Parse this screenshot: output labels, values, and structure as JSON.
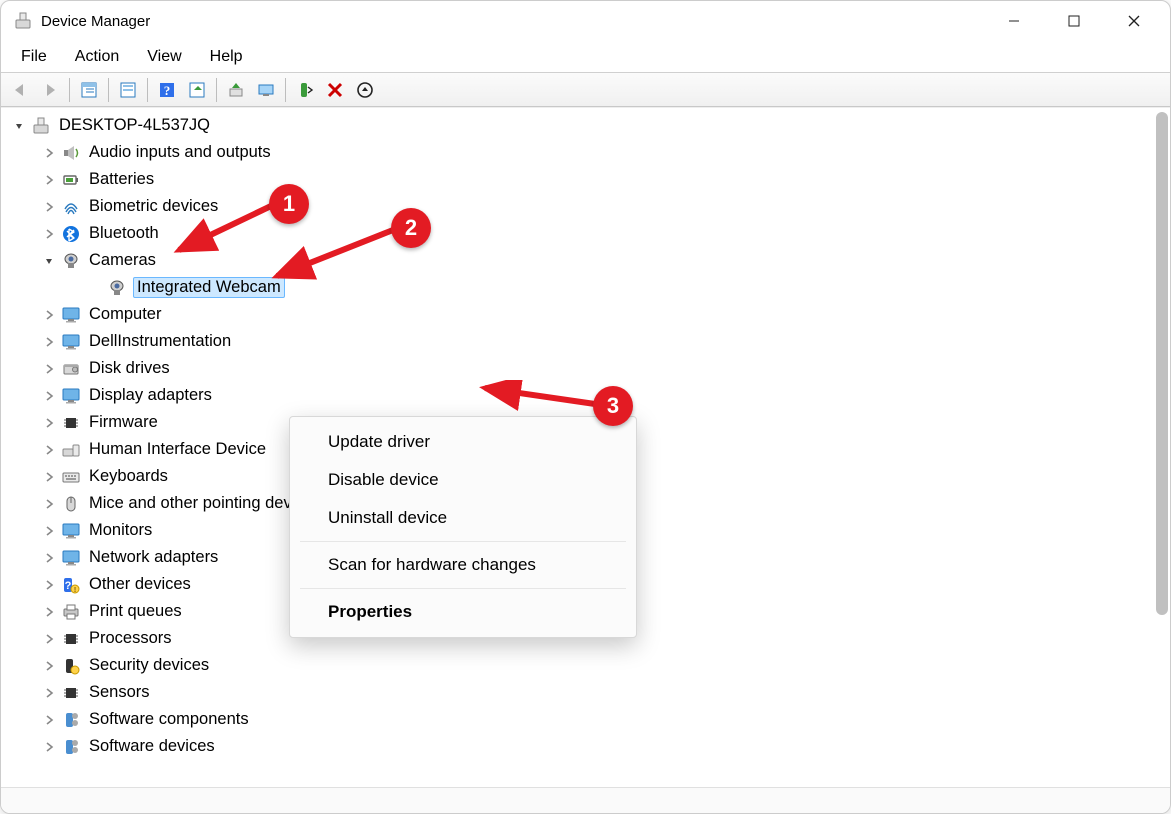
{
  "window": {
    "title": "Device Manager"
  },
  "menu": {
    "file": "File",
    "action": "Action",
    "view": "View",
    "help": "Help"
  },
  "tree": {
    "root": "DESKTOP-4L537JQ",
    "categories": [
      {
        "label": "Audio inputs and outputs"
      },
      {
        "label": "Batteries"
      },
      {
        "label": "Biometric devices"
      },
      {
        "label": "Bluetooth"
      },
      {
        "label": "Cameras",
        "expanded": true,
        "children": [
          {
            "label": "Integrated Webcam",
            "selected": true
          }
        ]
      },
      {
        "label": "Computer"
      },
      {
        "label": "DellInstrumentation"
      },
      {
        "label": "Disk drives"
      },
      {
        "label": "Display adapters"
      },
      {
        "label": "Firmware"
      },
      {
        "label": "Human Interface Device"
      },
      {
        "label": "Keyboards"
      },
      {
        "label": "Mice and other pointing devices"
      },
      {
        "label": "Monitors"
      },
      {
        "label": "Network adapters"
      },
      {
        "label": "Other devices"
      },
      {
        "label": "Print queues"
      },
      {
        "label": "Processors"
      },
      {
        "label": "Security devices"
      },
      {
        "label": "Sensors"
      },
      {
        "label": "Software components"
      },
      {
        "label": "Software devices"
      }
    ]
  },
  "icons": {
    "Audio inputs and outputs": "speaker",
    "Batteries": "battery",
    "Biometric devices": "fingerprint",
    "Bluetooth": "bluetooth",
    "Cameras": "camera",
    "Computer": "monitor",
    "DellInstrumentation": "monitor",
    "Disk drives": "disk",
    "Display adapters": "monitor",
    "Firmware": "chip",
    "Human Interface Device": "hid",
    "Keyboards": "keyboard",
    "Mice and other pointing devices": "mouse",
    "Monitors": "monitor",
    "Network adapters": "monitor",
    "Other devices": "question",
    "Print queues": "printer",
    "Processors": "chip",
    "Security devices": "security",
    "Sensors": "chip",
    "Software components": "soft",
    "Software devices": "soft",
    "Integrated Webcam": "camera"
  },
  "contextMenu": {
    "update": "Update driver",
    "disable": "Disable device",
    "uninstall": "Uninstall device",
    "scan": "Scan for hardware changes",
    "properties": "Properties"
  },
  "annotations": {
    "1": "1",
    "2": "2",
    "3": "3"
  }
}
